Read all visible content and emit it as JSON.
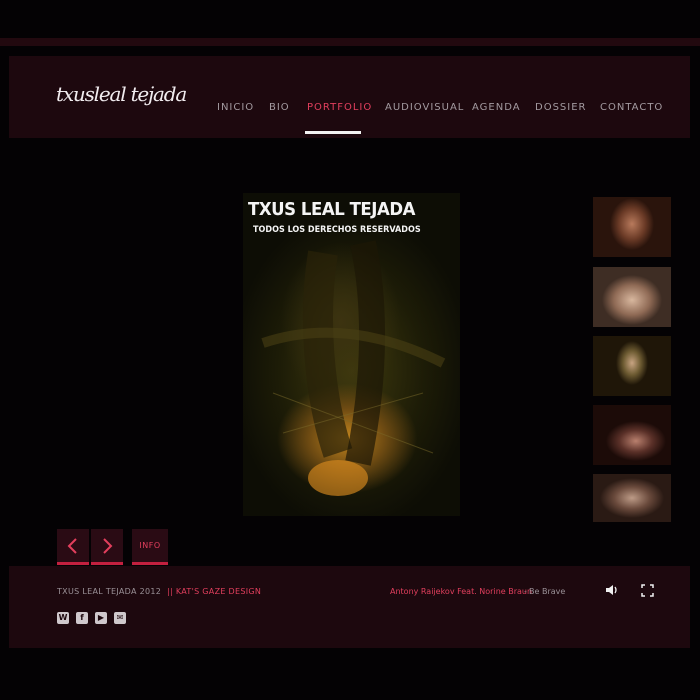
{
  "header": {
    "logo_text": "txusleal tejada",
    "nav": [
      {
        "label": "INICIO",
        "active": false
      },
      {
        "label": "BIO",
        "active": false
      },
      {
        "label": "PORTFOLIO",
        "active": true
      },
      {
        "label": "AUDIOVISUAL",
        "active": false
      },
      {
        "label": "AGENDA",
        "active": false
      },
      {
        "label": "DOSSIER",
        "active": false
      },
      {
        "label": "CONTACTO",
        "active": false
      }
    ]
  },
  "gallery": {
    "main_title": "TXUS LEAL TEJADA",
    "main_subtitle": "TODOS LOS DERECHOS RESERVADOS",
    "thumbnail_count": 5,
    "controls": {
      "prev_icon": "chevron-left-icon",
      "next_icon": "chevron-right-icon",
      "info_label": "INFO"
    }
  },
  "footer": {
    "copyright": "TXUS LEAL TEJADA 2012",
    "credit": "|| KAT'S GAZE DESIGN",
    "now_playing_artist": "Antony Raijekov Feat. Norine Braun",
    "now_playing_separator": "-",
    "now_playing_title": "Be Brave",
    "icons": [
      "volume-icon",
      "fullscreen-icon"
    ],
    "social_icons": [
      "wordpress-icon",
      "facebook-icon",
      "youtube-icon",
      "email-icon"
    ]
  },
  "colors": {
    "background": "#040204",
    "panel": "#1d080e",
    "accent": "#e23f5d",
    "text": "#a39aa0"
  }
}
